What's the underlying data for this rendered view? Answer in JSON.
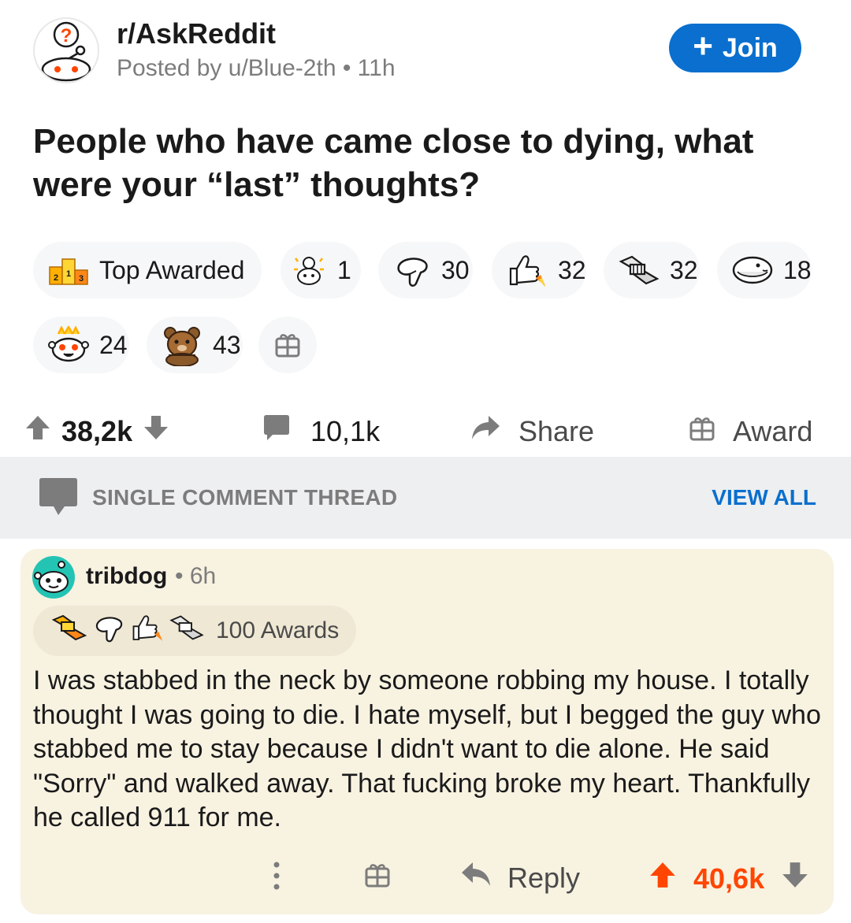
{
  "post": {
    "subreddit": "r/AskReddit",
    "posted_by": "Posted by u/Blue-2th • 11h",
    "join_label": "Join",
    "title": "People who have came close to dying, what were your “last” thoughts?"
  },
  "awards": {
    "top_awarded_label": "Top Awarded",
    "items": [
      {
        "icon": "ternion-icon",
        "count": "1"
      },
      {
        "icon": "wholesome-hand-icon",
        "count": "30"
      },
      {
        "icon": "thumbs-rocket-icon",
        "count": "32"
      },
      {
        "icon": "handshake-icon",
        "count": "32"
      },
      {
        "icon": "seal-icon",
        "count": "18"
      },
      {
        "icon": "snoo-gold-icon",
        "count": "24"
      },
      {
        "icon": "bear-icon",
        "count": "43"
      }
    ]
  },
  "actions": {
    "upvotes": "38,2k",
    "comments": "10,1k",
    "share": "Share",
    "award": "Award"
  },
  "thread": {
    "label": "SINGLE COMMENT THREAD",
    "view_all": "VIEW ALL"
  },
  "comment": {
    "user": "tribdog",
    "time": "• 6h",
    "awards_label": "100 Awards",
    "body": "I was stabbed in the neck by someone robbing my house. I totally thought I was going to die. I hate myself, but I begged the guy who stabbed me to stay because I didn't want to die alone. He said \"Sorry\" and walked away. That fucking broke my heart. Thankfully he called 911 for me.",
    "reply": "Reply",
    "votes": "40,6k"
  },
  "colors": {
    "accent_blue": "#0a6fce",
    "upvote_orange": "#ff4500",
    "comment_bg": "#f8f2e1",
    "thread_bg": "#edeff1"
  }
}
